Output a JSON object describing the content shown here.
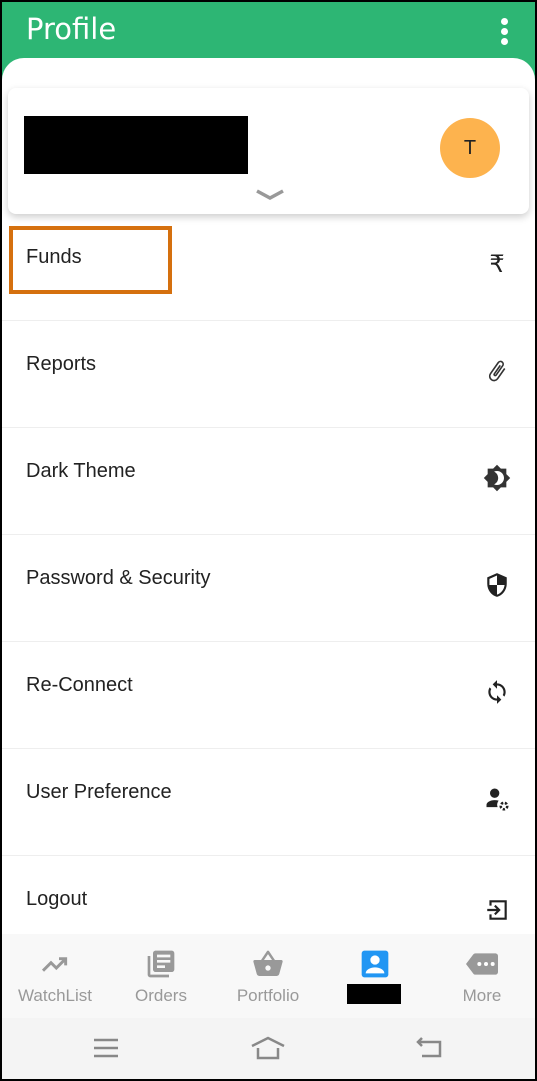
{
  "header": {
    "title": "Profile",
    "menu_icon": "more-vert-icon"
  },
  "account": {
    "name": "[redacted]",
    "avatar_initial": "T",
    "avatar_color": "#fdb34e",
    "expand_icon": "chevron-down-icon"
  },
  "menu": [
    {
      "label": "Funds",
      "icon": "rupee-icon",
      "highlighted": true
    },
    {
      "label": "Reports",
      "icon": "paperclip-icon"
    },
    {
      "label": "Dark Theme",
      "icon": "brightness-icon"
    },
    {
      "label": "Password & Security",
      "icon": "shield-icon"
    },
    {
      "label": "Re-Connect",
      "icon": "sync-icon"
    },
    {
      "label": "User Preference",
      "icon": "user-settings-icon"
    },
    {
      "label": "Logout",
      "icon": "logout-icon"
    }
  ],
  "bottom_nav": [
    {
      "label": "WatchList",
      "icon": "trending-up-icon"
    },
    {
      "label": "Orders",
      "icon": "orders-icon"
    },
    {
      "label": "Portfolio",
      "icon": "basket-icon"
    },
    {
      "label": "[redacted]",
      "icon": "profile-icon",
      "active": true
    },
    {
      "label": "More",
      "icon": "more-tag-icon"
    }
  ],
  "colors": {
    "header": "#2db674",
    "highlight": "#d5700e",
    "active_tab": "#2196f3",
    "inactive": "#999999"
  },
  "rupee_symbol": "₹"
}
